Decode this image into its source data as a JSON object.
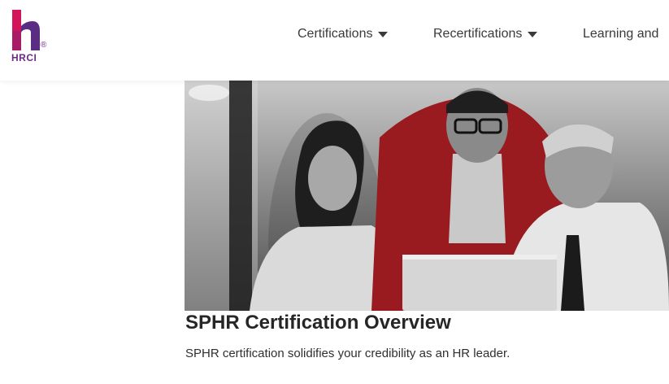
{
  "brand": {
    "logo_text": "HRCI",
    "registered_mark": "®",
    "colors": {
      "h_magenta": "#d4145a",
      "h_purple": "#5b2c83"
    }
  },
  "nav": {
    "items": [
      {
        "label": "Certifications",
        "icon": "caret-down-icon"
      },
      {
        "label": "Recertifications",
        "icon": "caret-down-icon"
      },
      {
        "label": "Learning and"
      }
    ]
  },
  "hero": {
    "image": "people-at-laptop-photo"
  },
  "content": {
    "title": "SPHR Certification Overview",
    "subtitle": "SPHR certification solidifies your credibility as an HR leader."
  }
}
